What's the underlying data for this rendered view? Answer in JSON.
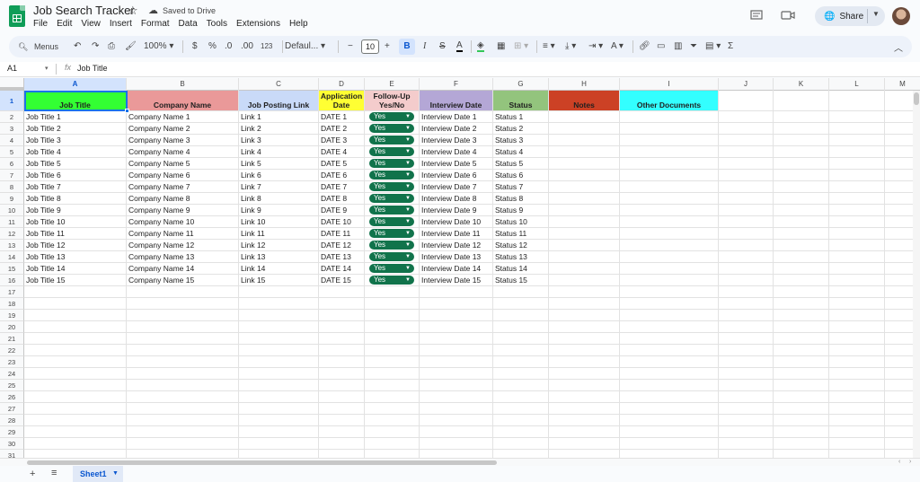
{
  "app": {
    "title": "Job Search Tracker",
    "star": "☆",
    "saved": "Saved to Drive",
    "menu": [
      "File",
      "Edit",
      "View",
      "Insert",
      "Format",
      "Data",
      "Tools",
      "Extensions",
      "Help"
    ],
    "share": "Share"
  },
  "toolbar": {
    "menus": "Menus",
    "zoom": "100%",
    "currency": "$",
    "percent": "%",
    "dec_decrease": ".0",
    "dec_increase": ".00",
    "num_format": "123",
    "font": "Defaul...",
    "font_size": "10",
    "minus": "−",
    "plus": "+",
    "bold": "B",
    "italic": "I",
    "strike": "S",
    "text_color": "A",
    "sum": "Σ"
  },
  "formula_bar": {
    "name_box": "A1",
    "fx": "fx",
    "value": "Job Title"
  },
  "columns": [
    "A",
    "B",
    "C",
    "D",
    "E",
    "F",
    "G",
    "H",
    "I",
    "J",
    "K",
    "L",
    "M"
  ],
  "header_row": {
    "A": "Job Title",
    "B": "Company Name",
    "C": "Job Posting Link",
    "D": "Application Date",
    "E": "Follow-Up Yes/No",
    "F": "Interview Date",
    "G": "Status",
    "H": "Notes",
    "I": "Other Documents"
  },
  "header_colors": {
    "A": "#33ff33",
    "B": "#ea9999",
    "C": "#c9daf8",
    "D": "#ffff33",
    "E": "#f4cccc",
    "F": "#b4a7d6",
    "G": "#93c47d",
    "H": "#cc4125",
    "I": "#33ffff"
  },
  "rows": [
    {
      "job": "Job Title 1",
      "company": "Company Name 1",
      "link": "Link 1",
      "date": "DATE 1",
      "follow": "Yes",
      "interview": "Interview Date 1",
      "status": "Status 1"
    },
    {
      "job": "Job Title 2",
      "company": "Company Name 2",
      "link": "Link 2",
      "date": "DATE 2",
      "follow": "Yes",
      "interview": "Interview Date 2",
      "status": "Status 2"
    },
    {
      "job": "Job Title 3",
      "company": "Company Name 3",
      "link": "Link 3",
      "date": "DATE 3",
      "follow": "Yes",
      "interview": "Interview Date 3",
      "status": "Status 3"
    },
    {
      "job": "Job Title 4",
      "company": "Company Name 4",
      "link": "Link 4",
      "date": "DATE 4",
      "follow": "Yes",
      "interview": "Interview Date 4",
      "status": "Status 4"
    },
    {
      "job": "Job Title 5",
      "company": "Company Name 5",
      "link": "Link 5",
      "date": "DATE 5",
      "follow": "Yes",
      "interview": "Interview Date 5",
      "status": "Status 5"
    },
    {
      "job": "Job Title 6",
      "company": "Company Name 6",
      "link": "Link 6",
      "date": "DATE 6",
      "follow": "Yes",
      "interview": "Interview Date 6",
      "status": "Status 6"
    },
    {
      "job": "Job Title 7",
      "company": "Company Name 7",
      "link": "Link 7",
      "date": "DATE 7",
      "follow": "Yes",
      "interview": "Interview Date 7",
      "status": "Status 7"
    },
    {
      "job": "Job Title 8",
      "company": "Company Name 8",
      "link": "Link 8",
      "date": "DATE 8",
      "follow": "Yes",
      "interview": "Interview Date 8",
      "status": "Status 8"
    },
    {
      "job": "Job Title 9",
      "company": "Company Name 9",
      "link": "Link 9",
      "date": "DATE 9",
      "follow": "Yes",
      "interview": "Interview Date 9",
      "status": "Status 9"
    },
    {
      "job": "Job Title 10",
      "company": "Company Name 10",
      "link": "Link 10",
      "date": "DATE 10",
      "follow": "Yes",
      "interview": "Interview Date 10",
      "status": "Status 10"
    },
    {
      "job": "Job Title 11",
      "company": "Company Name 11",
      "link": "Link 11",
      "date": "DATE 11",
      "follow": "Yes",
      "interview": "Interview Date 11",
      "status": "Status 11"
    },
    {
      "job": "Job Title 12",
      "company": "Company Name 12",
      "link": "Link 12",
      "date": "DATE 12",
      "follow": "Yes",
      "interview": "Interview Date 12",
      "status": "Status 12"
    },
    {
      "job": "Job Title 13",
      "company": "Company Name 13",
      "link": "Link 13",
      "date": "DATE 13",
      "follow": "Yes",
      "interview": "Interview Date 13",
      "status": "Status 13"
    },
    {
      "job": "Job Title 14",
      "company": "Company Name 14",
      "link": "Link 14",
      "date": "DATE 14",
      "follow": "Yes",
      "interview": "Interview Date 14",
      "status": "Status 14"
    },
    {
      "job": "Job Title 15",
      "company": "Company Name 15",
      "link": "Link 15",
      "date": "DATE 15",
      "follow": "Yes",
      "interview": "Interview Date 15",
      "status": "Status 15"
    }
  ],
  "row_numbers": [
    "1",
    "2",
    "3",
    "4",
    "5",
    "6",
    "7",
    "8",
    "9",
    "10",
    "11",
    "12",
    "13",
    "14",
    "15",
    "16",
    "17",
    "18",
    "19",
    "20",
    "21",
    "22",
    "23",
    "24",
    "25",
    "26",
    "27",
    "28",
    "29",
    "30",
    "31"
  ],
  "chip_color": "#11734b",
  "selection_color": "#1a73e8",
  "sheets": [
    "Sheet1"
  ]
}
